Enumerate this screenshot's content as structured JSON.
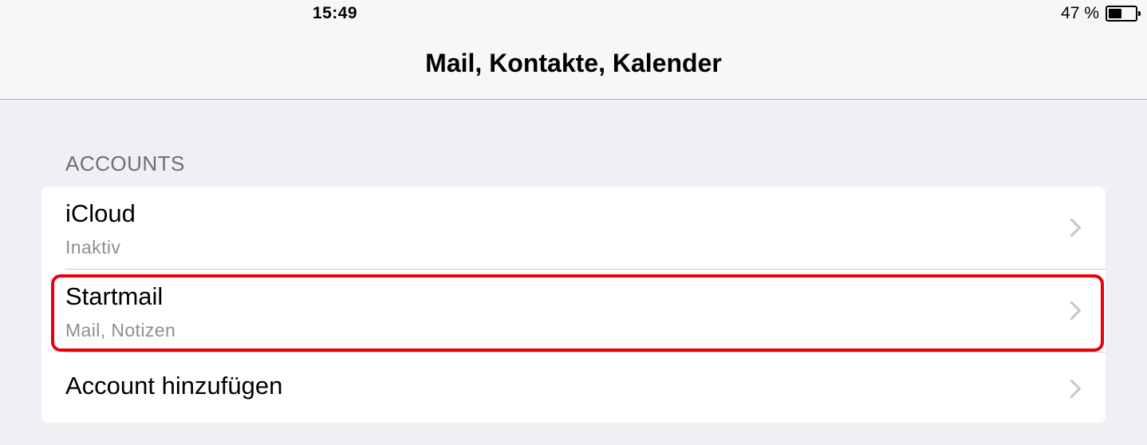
{
  "status_bar": {
    "time": "15:49",
    "battery_percent": "47 %",
    "battery_level": 0.47
  },
  "nav": {
    "title": "Mail, Kontakte, Kalender"
  },
  "accounts_section": {
    "header": "ACCOUNTS",
    "rows": [
      {
        "title": "iCloud",
        "subtitle": "Inaktiv"
      },
      {
        "title": "Startmail",
        "subtitle": "Mail, Notizen"
      },
      {
        "title": "Account hinzufügen"
      }
    ]
  },
  "annotation": {
    "highlight_color": "#e8000a"
  }
}
